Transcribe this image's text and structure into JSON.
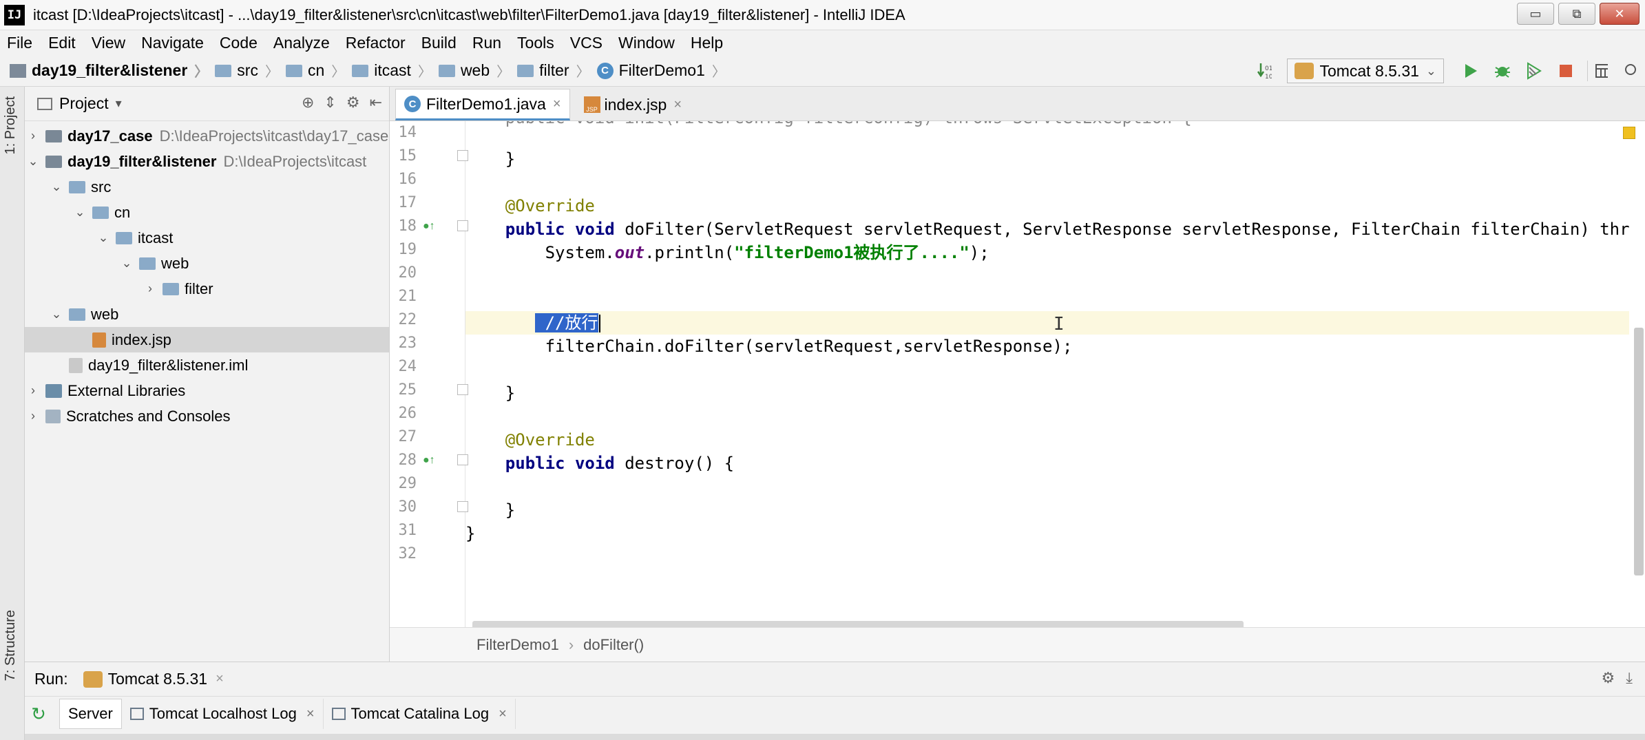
{
  "window": {
    "app_logo": "IJ",
    "title": "itcast [D:\\IdeaProjects\\itcast] - ...\\day19_filter&listener\\src\\cn\\itcast\\web\\filter\\FilterDemo1.java [day19_filter&listener] - IntelliJ IDEA",
    "buttons": {
      "minimize": "▭",
      "maximize": "⧉",
      "close": "✕"
    }
  },
  "menu": [
    "File",
    "Edit",
    "View",
    "Navigate",
    "Code",
    "Analyze",
    "Refactor",
    "Build",
    "Run",
    "Tools",
    "VCS",
    "Window",
    "Help"
  ],
  "navbar": {
    "crumbs": [
      "day19_filter&listener",
      "src",
      "cn",
      "itcast",
      "web",
      "filter",
      "FilterDemo1"
    ],
    "class_icon": "C",
    "run_config": "Tomcat 8.5.31",
    "icons": [
      "build-icon",
      "run-icon",
      "debug-icon",
      "coverage-icon",
      "stop-icon",
      "project-structure-icon",
      "search-icon"
    ]
  },
  "left_strip": {
    "project_tab": "1: Project",
    "structure_tab": "7: Structure"
  },
  "project_panel": {
    "title": "Project",
    "dropdown": "▾",
    "tree": [
      {
        "arrow": "›",
        "label": "day17_case",
        "path": "D:\\IdeaProjects\\itcast\\day17_case",
        "icon": "module-icon",
        "bold": true
      },
      {
        "arrow": "⌄",
        "label": "day19_filter&listener",
        "path": "D:\\IdeaProjects\\itcast",
        "icon": "module-icon",
        "bold": true
      },
      {
        "arrow": "⌄",
        "label": "src",
        "icon": "folder-icon"
      },
      {
        "arrow": "⌄",
        "label": "cn",
        "icon": "folder-icon"
      },
      {
        "arrow": "⌄",
        "label": "itcast",
        "icon": "folder-icon"
      },
      {
        "arrow": "⌄",
        "label": "web",
        "icon": "folder-icon"
      },
      {
        "arrow": "›",
        "label": "filter",
        "icon": "folder-icon"
      },
      {
        "arrow": "⌄",
        "label": "web",
        "icon": "web-folder-icon"
      },
      {
        "arrow": "",
        "label": "index.jsp",
        "icon": "jsp-file-icon",
        "selected": true
      },
      {
        "arrow": "",
        "label": "day19_filter&listener.iml",
        "icon": "iml-file-icon"
      },
      {
        "arrow": "›",
        "label": "External Libraries",
        "icon": "library-icon"
      },
      {
        "arrow": "›",
        "label": "Scratches and Consoles",
        "icon": "scratches-icon"
      }
    ]
  },
  "editor": {
    "tabs": [
      {
        "label": "FilterDemo1.java",
        "active": true,
        "icon": "java-class-icon"
      },
      {
        "label": "index.jsp",
        "active": false,
        "icon": "jsp-file-icon"
      }
    ],
    "line_numbers": [
      "14",
      "15",
      "16",
      "17",
      "18",
      "19",
      "20",
      "21",
      "22",
      "23",
      "24",
      "25",
      "26",
      "27",
      "28",
      "29",
      "30",
      "31",
      "32"
    ],
    "code": {
      "l13_partial": "    public void init(FilterConfig filterConfig) throws ServletException {",
      "l15": "    }",
      "l17": "    @Override",
      "l18_kw": "    public void ",
      "l18_rest": "doFilter(ServletRequest servletRequest, ServletResponse servletResponse, FilterChain filterChain) throws IOException, ServletException {",
      "l19_a": "        System.",
      "l19_out": "out",
      "l19_b": ".println(",
      "l19_str": "\"filterDemo1被执行了....\"",
      "l19_c": ");",
      "l22_indent": "       ",
      "l22_comment": " //放行",
      "l23": "        filterChain.doFilter(servletRequest,servletResponse);",
      "l25": "    }",
      "l27": "    @Override",
      "l28_kw": "    public void ",
      "l28_rest": "destroy() {",
      "l30": "    }",
      "l31": "}"
    },
    "breadcrumb": [
      "FilterDemo1",
      "doFilter()"
    ]
  },
  "run_panel": {
    "label": "Run:",
    "config": "Tomcat 8.5.31",
    "tabs": [
      "Server",
      "Tomcat Localhost Log",
      "Tomcat Catalina Log"
    ],
    "close": "×"
  },
  "colors": {
    "keyword": "#000080",
    "annotation": "#808000",
    "string": "#008000",
    "comment": "#808080",
    "selection": "#2f65ca",
    "accent": "#4e8ec6"
  }
}
